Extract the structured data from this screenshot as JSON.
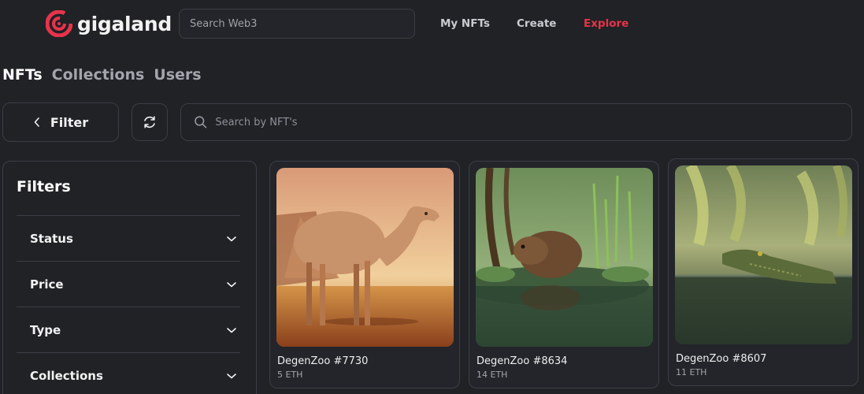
{
  "header": {
    "logo_text": "gigaland",
    "search_placeholder": "Search Web3",
    "nav": {
      "my_nfts": "My NFTs",
      "create": "Create",
      "explore": "Explore"
    },
    "accent_color": "#e8334a"
  },
  "tabs": [
    {
      "label": "NFTs",
      "active": true
    },
    {
      "label": "Collections",
      "active": false
    },
    {
      "label": "Users",
      "active": false
    }
  ],
  "toolbar": {
    "filter_label": "Filter",
    "search_placeholder": "Search by NFT's"
  },
  "filters": {
    "title": "Filters",
    "sections": [
      "Status",
      "Price",
      "Type",
      "Collections"
    ]
  },
  "nfts": [
    {
      "name": "DegenZoo #7730",
      "price": "5 ETH",
      "subject": "camel in desert"
    },
    {
      "name": "DegenZoo #8634",
      "price": "14 ETH",
      "subject": "beaver in swamp"
    },
    {
      "name": "DegenZoo #8607",
      "price": "11 ETH",
      "subject": "crocodile in river"
    }
  ]
}
